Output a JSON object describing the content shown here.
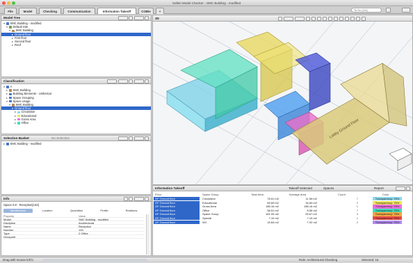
{
  "window": {
    "title": "Solibri Model Checker - SMC Building - modified"
  },
  "tabs": [
    {
      "label": "File"
    },
    {
      "label": "Model"
    },
    {
      "label": "Checking"
    },
    {
      "label": "Communication"
    },
    {
      "label": "Information Takeoff"
    },
    {
      "label": "COBie"
    },
    {
      "label": "+"
    }
  ],
  "search": {
    "placeholder": "To Do (1/4)"
  },
  "model_tree": {
    "title": "Model Tree",
    "items": [
      "SMC Building - modified",
      "Default Site",
      "SMC Building",
      "Ground floor",
      "First floor",
      "Second floor",
      "Roof"
    ]
  },
  "classification": {
    "title": "Classification",
    "items": [
      "SMC Building",
      "Building Elements - Uniformat",
      "Space Grouping",
      "Space Usage",
      "SMC Building",
      "Ground floor",
      "Circulation",
      "Educational",
      "Gross Area",
      "Office"
    ]
  },
  "selection_basket": {
    "title": "Selection Basket",
    "filter": "No Selection",
    "items": [
      "SMC Building - modified"
    ]
  },
  "info": {
    "title": "Info",
    "subject": "Space 0.8 - Reception[133]",
    "tabs": [
      "Identification",
      "Location",
      "Quantities",
      "Profile",
      "Relations"
    ],
    "columns": [
      "Property",
      "Value"
    ],
    "rows": [
      {
        "k": "Model",
        "v": "SMC Building - modified"
      },
      {
        "k": "Discipline",
        "v": "Architectural"
      },
      {
        "k": "Name",
        "v": "Reception"
      },
      {
        "k": "Number",
        "v": "133"
      },
      {
        "k": "Type",
        "v": "2 Office"
      },
      {
        "k": "Occupant",
        "v": ""
      }
    ]
  },
  "viewport": {
    "title": "3D",
    "floor_label": "Lobby Ground Floor"
  },
  "takeoff": {
    "title": "Information Takeoff",
    "selector": "Takeoff Selected",
    "spaces": "Spaces",
    "report": "Report",
    "columns": [
      "Floor",
      "Space Group",
      "Total Area",
      "Average Area",
      "Count",
      "Color"
    ],
    "rows": [
      {
        "floor": "GF Ground floor",
        "group": "Circulation",
        "total": "78.51 m2",
        "avg": "11.56 m2",
        "count": "7",
        "color": "Transparency: 75%",
        "swatch": "#8fd9ec"
      },
      {
        "floor": "GF Ground floor",
        "group": "Educational",
        "total": "69.69 m2",
        "avg": "34.84 m2",
        "count": "2",
        "color": "Transparency: 75%",
        "swatch": "#f0e55a"
      },
      {
        "floor": "GF Ground floor",
        "group": "Gross Area",
        "total": "185.16 m2",
        "avg": "185.16 m2",
        "count": "1",
        "color": "Transparency: 75%",
        "swatch": "#ec6fe0"
      },
      {
        "floor": "GF Ground floor",
        "group": "Office",
        "total": "58.51 m2",
        "avg": "8.58 m2",
        "count": "7",
        "color": "Transparency: 75%",
        "swatch": "#3fe0b8"
      },
      {
        "floor": "GF Ground floor",
        "group": "Space Group",
        "total": "161.05 m2",
        "avg": "53.67 m2",
        "count": "3",
        "color": "Transparency: 75%",
        "swatch": "#f2a641"
      },
      {
        "floor": "GF Ground floor",
        "group": "Special",
        "total": "7.15 m2",
        "avg": "7.15 m2",
        "count": "1",
        "color": "Transparency: 75%",
        "swatch": "#e84a4a"
      },
      {
        "floor": "GF Ground floor",
        "group": "WC",
        "total": "15.84 m2",
        "avg": "7.92 m2",
        "count": "2",
        "color": "Transparency: 75%",
        "swatch": "#b38cf0"
      }
    ]
  },
  "status": {
    "left": "Drag with mouse left b",
    "role": "Role: Architectural Checking",
    "selected": "Selected: 18"
  }
}
